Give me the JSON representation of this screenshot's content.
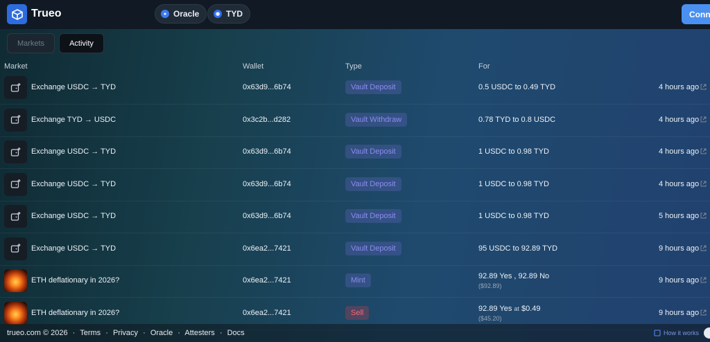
{
  "brand": {
    "name": "Trueo"
  },
  "nav": {
    "pills": [
      {
        "label": "Oracle",
        "icon": "oracle-icon"
      },
      {
        "label": "TYD",
        "icon": "tyd-icon"
      }
    ],
    "connect_label": "Connect"
  },
  "tabs": [
    {
      "label": "Markets",
      "active": false
    },
    {
      "label": "Activity",
      "active": true
    }
  ],
  "table": {
    "columns": [
      "Market",
      "Wallet",
      "Type",
      "For"
    ],
    "rows": [
      {
        "icon": "wallet-plus-icon",
        "market": "Exchange USDC → TYD",
        "wallet": "0x63d9...6b74",
        "type": "Vault Deposit",
        "for": "0.5 USDC to 0.49 TYD",
        "for_sub": "",
        "time": "4 hours ago"
      },
      {
        "icon": "wallet-plus-icon",
        "market": "Exchange TYD → USDC",
        "wallet": "0x3c2b...d282",
        "type": "Vault Withdraw",
        "for": "0.78 TYD to 0.8 USDC",
        "for_sub": "",
        "time": "4 hours ago"
      },
      {
        "icon": "wallet-plus-icon",
        "market": "Exchange USDC → TYD",
        "wallet": "0x63d9...6b74",
        "type": "Vault Deposit",
        "for": "1 USDC to 0.98 TYD",
        "for_sub": "",
        "time": "4 hours ago"
      },
      {
        "icon": "wallet-plus-icon",
        "market": "Exchange USDC → TYD",
        "wallet": "0x63d9...6b74",
        "type": "Vault Deposit",
        "for": "1 USDC to 0.98 TYD",
        "for_sub": "",
        "time": "4 hours ago"
      },
      {
        "icon": "wallet-plus-icon",
        "market": "Exchange USDC → TYD",
        "wallet": "0x63d9...6b74",
        "type": "Vault Deposit",
        "for": "1 USDC to 0.98 TYD",
        "for_sub": "",
        "time": "5 hours ago"
      },
      {
        "icon": "wallet-plus-icon",
        "market": "Exchange USDC → TYD",
        "wallet": "0x6ea2...7421",
        "type": "Vault Deposit",
        "for": "95 USDC to 92.89 TYD",
        "for_sub": "",
        "time": "9 hours ago"
      },
      {
        "icon": "eth-fire-thumbnail",
        "market": "ETH deflationary in 2026?",
        "wallet": "0x6ea2...7421",
        "type": "Mint",
        "for": "92.89 Yes , 92.89 No",
        "for_sub": "($92.89)",
        "time": "9 hours ago"
      },
      {
        "icon": "eth-fire-thumbnail",
        "market": "ETH deflationary in 2026?",
        "wallet": "0x6ea2...7421",
        "type": "Sell",
        "for": "92.89 Yes",
        "for_at": "at",
        "for_price": "$0.49",
        "for_sub": "($45.20)",
        "time": "9 hours ago"
      }
    ]
  },
  "footer": {
    "links": [
      "trueo.com © 2026",
      "·",
      "Terms",
      "·",
      "Privacy",
      "·",
      "Oracle",
      "·",
      "Attesters",
      "·",
      "Docs"
    ],
    "how_it_works": "How it works"
  },
  "colors": {
    "accent": "#4a90f0",
    "logo": "#2d6cdf",
    "type_badge_text": "#8d8cf0",
    "sell_badge_text": "#f06a7a"
  }
}
